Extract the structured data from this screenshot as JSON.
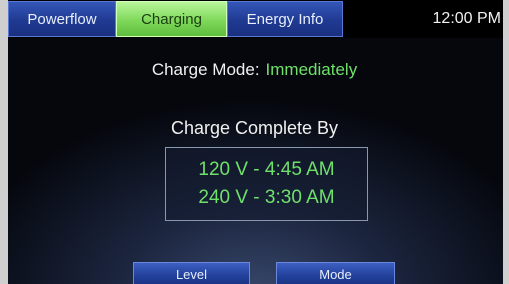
{
  "tabs": {
    "powerflow": "Powerflow",
    "charging": "Charging",
    "energy_info": "Energy Info"
  },
  "clock": "12:00 PM",
  "charge_mode": {
    "label": "Charge Mode:",
    "value": "Immediately"
  },
  "charge_complete_by": {
    "heading": "Charge Complete By",
    "times": [
      "120 V - 4:45 AM",
      "240 V - 3:30 AM"
    ]
  },
  "buttons": {
    "level": "Level",
    "mode": "Mode"
  },
  "colors": {
    "active_tab": "#7fd85a",
    "inactive_tab": "#1f3a92",
    "accent_text": "#6fe16a"
  }
}
